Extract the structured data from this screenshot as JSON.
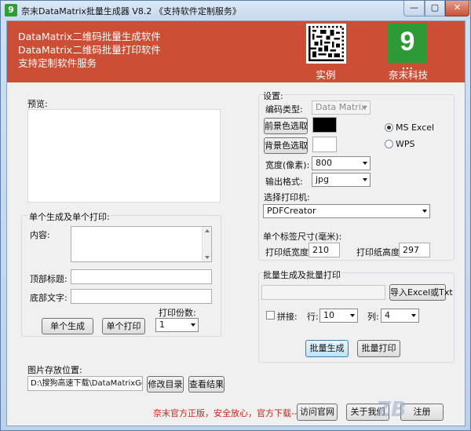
{
  "window": {
    "title": "奈末DataMatrix批量生成器 V8.2  《支持软件定制服务》",
    "min_glyph": "—",
    "max_glyph": "▢",
    "close_glyph": "✕"
  },
  "banner": {
    "line1": "DataMatrix二维码批量生成软件",
    "line2": "DataMatrix二维码批量打印软件",
    "line3": "支持定制软件服务",
    "example_label": "实例",
    "brand_label": "奈末科技",
    "brand_logo_text": "9",
    "brand_logo_dots": "..."
  },
  "preview": {
    "label": "预览:"
  },
  "single": {
    "group_title": "单个生成及单个打印:",
    "content_label": "内容:",
    "content_value": "",
    "top_title_label": "顶部标题:",
    "top_title_value": "",
    "bottom_text_label": "底部文字:",
    "bottom_text_value": "",
    "copies_label": "打印份数:",
    "copies_value": "1",
    "generate_button": "单个生成",
    "print_button": "单个打印"
  },
  "settings": {
    "group_title": "设置:",
    "code_type_label": "编码类型:",
    "code_type_value": "Data Matrix",
    "fg_button": "前景色选取",
    "bg_button": "背景色选取",
    "fg_color": "#000000",
    "bg_color": "#ffffff",
    "radio_ms_excel": "MS  Excel",
    "radio_wps": "WPS",
    "width_label": "宽度(像素):",
    "width_value": "800",
    "format_label": "输出格式:",
    "format_value": "jpg",
    "printer_label": "选择打印机:",
    "printer_value": "PDFCreator",
    "label_size_title": "单个标签尺寸(毫米):",
    "paper_width_label": "打印纸宽度:",
    "paper_width_value": "210",
    "paper_height_label": "打印纸高度:",
    "paper_height_value": "297"
  },
  "batch": {
    "group_title": "批量生成及批量打印",
    "file_value": "",
    "import_button": "导入Excel或Txt",
    "tile_label": "拼接:",
    "rows_label": "行:",
    "rows_value": "10",
    "cols_label": "列:",
    "cols_value": "4",
    "generate_button": "批量生成",
    "print_button": "批量打印"
  },
  "save": {
    "label": "图片存放位置:",
    "path_value": "D:\\搜狗高速下载\\DataMatrixGene",
    "change_button": "修改目录",
    "view_button": "查看结果"
  },
  "footer": {
    "notice": "奈末官方正版，安全放心，官方下载-->",
    "visit_button": "访问官网",
    "about_button": "关于我们",
    "register_button": "注册"
  },
  "colors": {
    "banner": "#cb4e35",
    "brand_green": "#2d9a35",
    "notice_red": "#c5281c"
  },
  "watermark": {
    "text": "ZB"
  }
}
